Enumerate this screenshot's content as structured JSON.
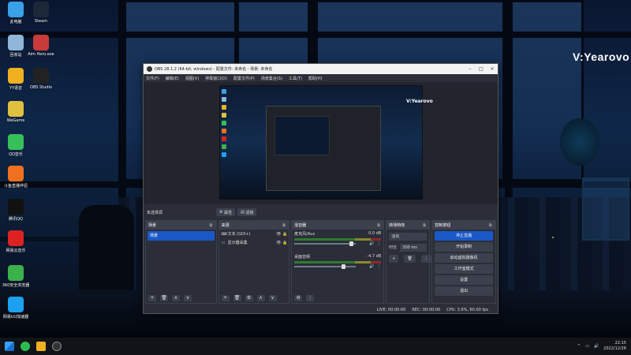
{
  "watermark": "V:Yearovo",
  "desktop_icons": [
    {
      "label": "此电脑",
      "icon": "computer-icon",
      "color": "#3aa0e8"
    },
    {
      "label": "Steam",
      "icon": "steam-icon",
      "color": "#1b2838"
    },
    {
      "label": "回收站",
      "icon": "recycle-bin-icon",
      "color": "#8fb5d8"
    },
    {
      "label": "Aim Hero.exe",
      "icon": "aim-hero-icon",
      "color": "#c93b3b"
    },
    {
      "label": "YY语音",
      "icon": "yy-icon",
      "color": "#f0b020"
    },
    {
      "label": "OBS Studio",
      "icon": "obs-icon",
      "color": "#222"
    },
    {
      "label": "WeGame",
      "icon": "wegame-icon",
      "color": "#e0c040"
    },
    {
      "label": "QQ音乐",
      "icon": "qqmusic-icon",
      "color": "#35c05a"
    },
    {
      "label": "斗鱼直播伴侣",
      "icon": "douyu-icon",
      "color": "#f07020"
    },
    {
      "label": "腾讯QQ",
      "icon": "qq-icon",
      "color": "#111"
    },
    {
      "label": "网易云音乐",
      "icon": "netease-music-icon",
      "color": "#d22"
    },
    {
      "label": "360安全浏览器",
      "icon": "360-browser-icon",
      "color": "#3bb14a"
    },
    {
      "label": "网易UU加速器",
      "icon": "uu-accelerator-icon",
      "color": "#1ea0f0"
    }
  ],
  "obs": {
    "title": "OBS 28.1.2 (64-bit, windows) - 配置文件: 未命名 - 场景: 未命名",
    "menu": [
      "文件(F)",
      "编辑(E)",
      "视图(V)",
      "停靠窗口(D)",
      "配置文件(P)",
      "场景集合(S)",
      "工具(T)",
      "帮助(H)"
    ],
    "preview_watermark": "V:Yearovo",
    "no_source_label": "未选择源",
    "props_button": "属性",
    "filters_button": "滤镜",
    "docks": {
      "scenes": {
        "title": "场景",
        "items": [
          "场景"
        ]
      },
      "sources": {
        "title": "来源",
        "items": [
          {
            "name": "文本 (GDI+)",
            "icon": "text-icon"
          },
          {
            "name": "显示器采集",
            "icon": "monitor-icon"
          }
        ]
      },
      "mixer": {
        "title": "混音器",
        "channels": [
          {
            "name": "麦克风/Aux",
            "db": "0.0 dB",
            "volume": 0.95
          },
          {
            "name": "桌面音频",
            "db": "-4.7 dB",
            "volume": 0.82
          }
        ]
      },
      "transitions": {
        "title": "转场特效",
        "selected": "淡出",
        "duration_label": "时长",
        "duration": "300 ms"
      },
      "controls": {
        "title": "控制按钮",
        "buttons": [
          {
            "label": "停止直播",
            "primary": true
          },
          {
            "label": "开始录制",
            "primary": false
          },
          {
            "label": "启动虚拟摄像机",
            "primary": false
          },
          {
            "label": "工作室模式",
            "primary": false
          },
          {
            "label": "设置",
            "primary": false
          },
          {
            "label": "退出",
            "primary": false
          }
        ]
      }
    },
    "status": {
      "live": "LIVE: 00:00:00",
      "rec": "REC: 00:00:00",
      "cpu": "CPU: 3.6%, 60.00 fps"
    }
  },
  "taskbar": {
    "apps": [
      "windows-start-icon",
      "wechat-icon",
      "yy-taskbar-icon",
      "obs-taskbar-icon"
    ],
    "time": "22:15",
    "date": "2022/12/26"
  }
}
